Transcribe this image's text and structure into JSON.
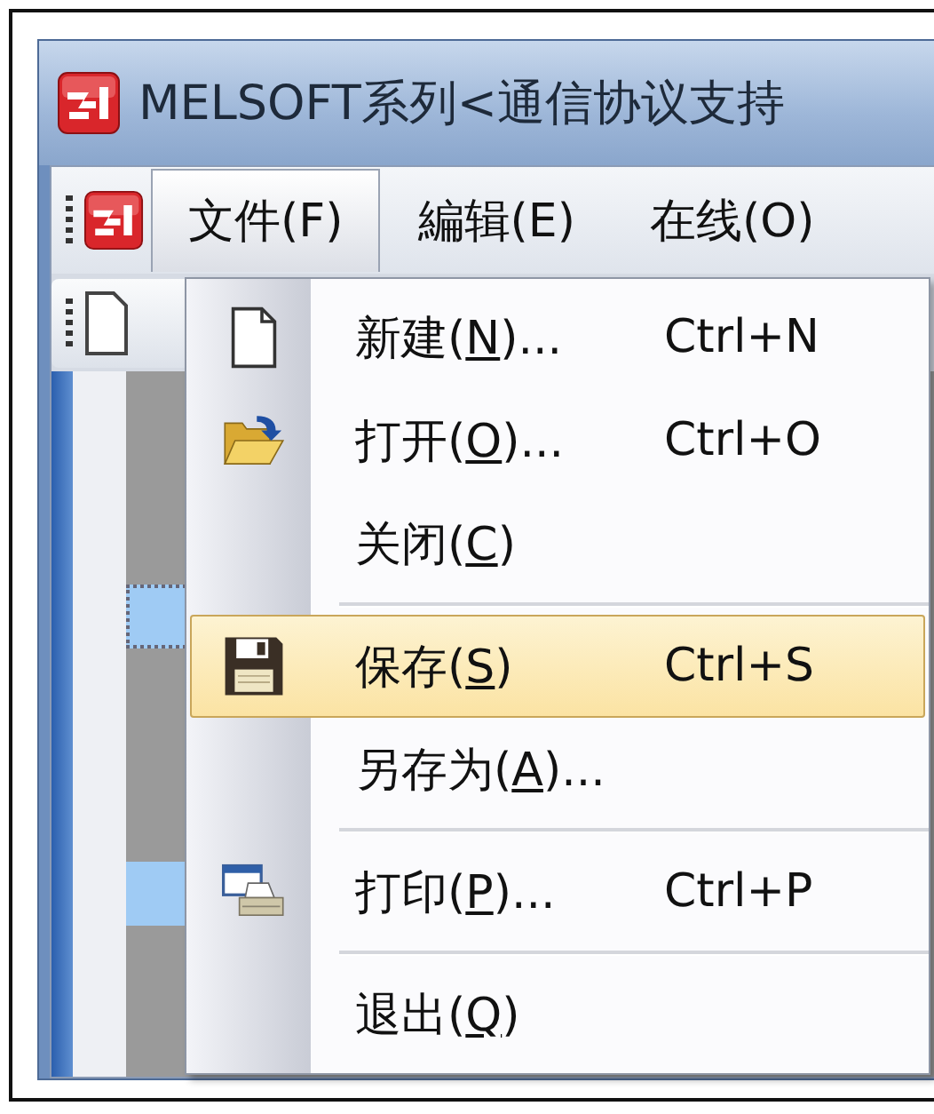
{
  "window": {
    "title": "MELSOFT系列<通信协议支持"
  },
  "menu_bar": [
    {
      "label": "文件(F)",
      "selected": true
    },
    {
      "label": "編辑(E)",
      "selected": false
    },
    {
      "label": "在线(O)",
      "selected": false
    }
  ],
  "file_menu": [
    {
      "kind": "new",
      "label_start": "新建(",
      "access_key": "N",
      "label_end": ")...",
      "shortcut": "Ctrl+N",
      "selected": false
    },
    {
      "kind": "open",
      "label_start": "打开(",
      "access_key": "O",
      "label_end": ")...",
      "shortcut": "Ctrl+O",
      "selected": false
    },
    {
      "kind": "plain",
      "label_start": "关闭(",
      "access_key": "C",
      "label_end": ")",
      "selected": false
    },
    {
      "kind": "separator"
    },
    {
      "kind": "save",
      "label_start": "保存(",
      "access_key": "S",
      "label_end": ")",
      "shortcut": "Ctrl+S",
      "selected": true
    },
    {
      "kind": "plain",
      "label_start": "另存为(",
      "access_key": "A",
      "label_end": ")...",
      "selected": false
    },
    {
      "kind": "separator"
    },
    {
      "kind": "print",
      "label_start": "打印(",
      "access_key": "P",
      "label_end": ")...",
      "shortcut": "Ctrl+P",
      "selected": false
    },
    {
      "kind": "separator"
    },
    {
      "kind": "plain",
      "label_start": "退出(",
      "access_key": "Q",
      "label_end": ")",
      "selected": false
    }
  ]
}
